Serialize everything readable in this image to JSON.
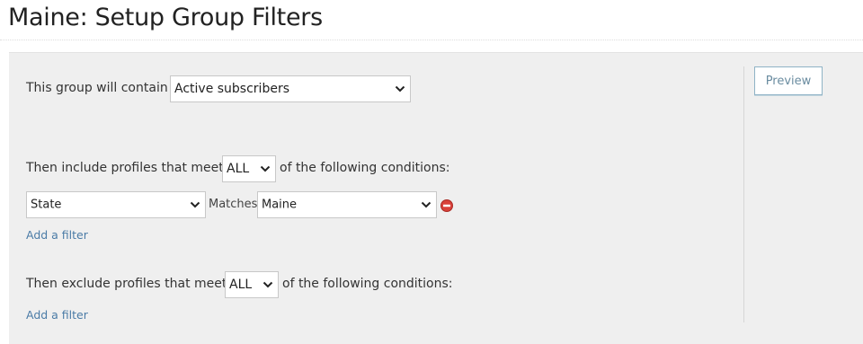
{
  "page": {
    "title": "Maine: Setup Group Filters"
  },
  "contain": {
    "label": "This group will contain",
    "selected": "Active subscribers"
  },
  "include": {
    "prefix": "Then include profiles that meet",
    "match_selected": "ALL",
    "suffix": "of the following conditions:",
    "filters": [
      {
        "field": "State",
        "operator": "Matches",
        "value": "Maine"
      }
    ],
    "add_filter_label": "Add a filter"
  },
  "exclude": {
    "prefix": "Then exclude profiles that meet",
    "match_selected": "ALL",
    "suffix": "of the following conditions:",
    "add_filter_label": "Add a filter"
  },
  "actions": {
    "preview_label": "Preview"
  },
  "icons": {
    "dropdown": "chevron-down-icon",
    "remove": "remove-circle-icon"
  },
  "colors": {
    "panel_background": "#efefef",
    "link": "#4a7ba6",
    "remove_icon": "#d9413a",
    "preview_border": "#8fb3c6"
  }
}
